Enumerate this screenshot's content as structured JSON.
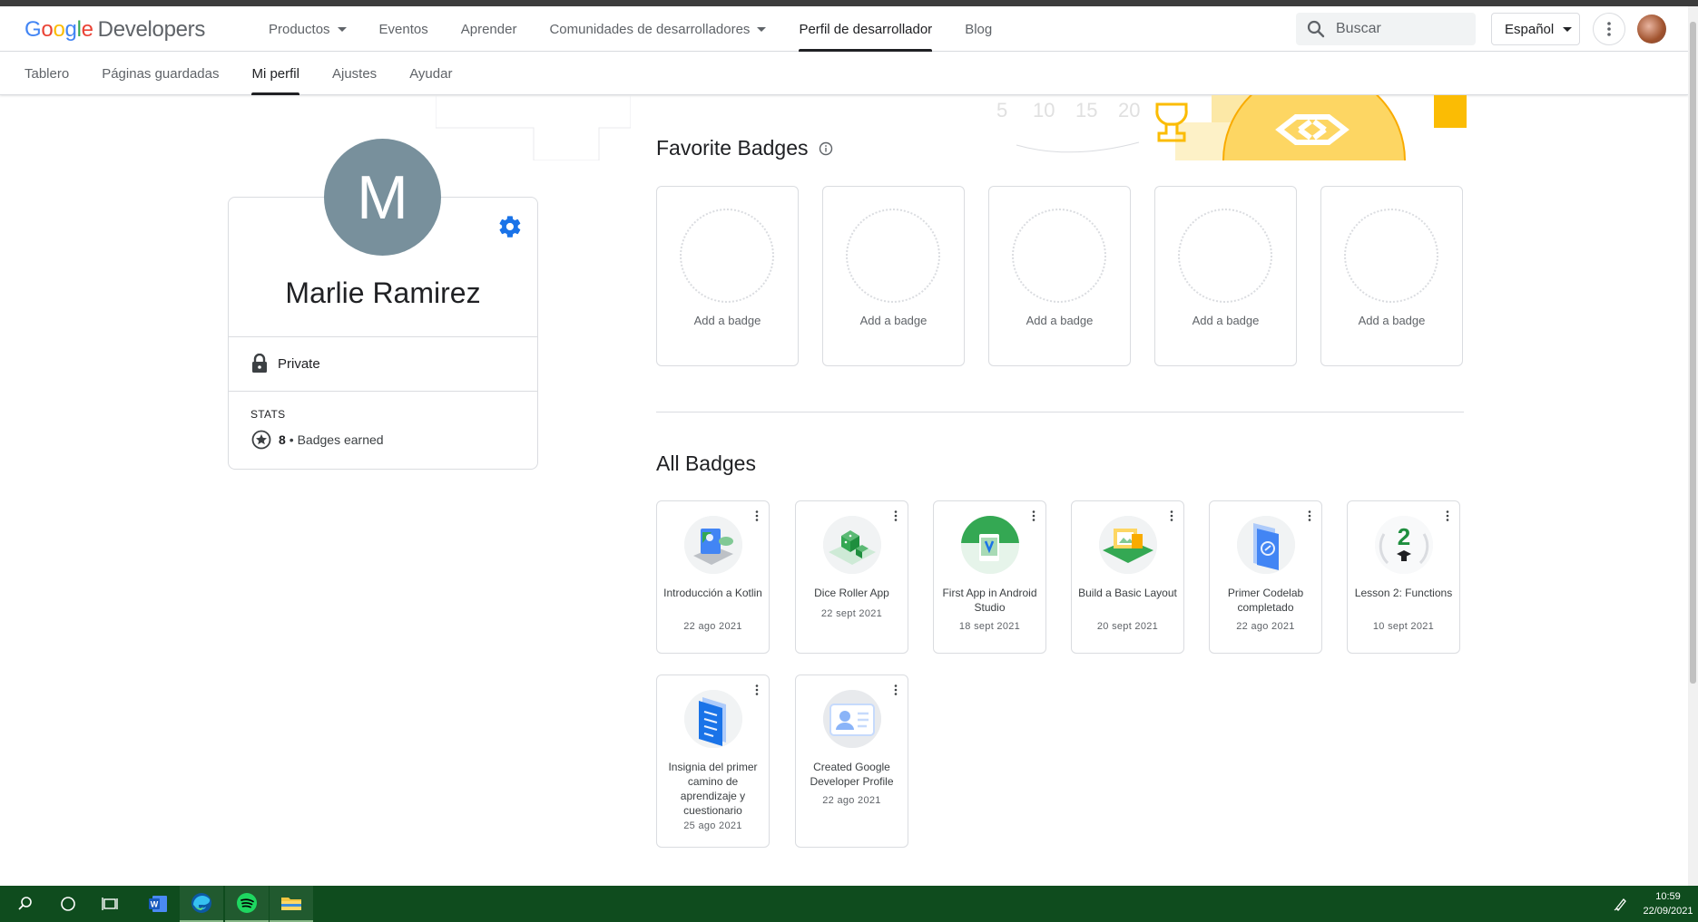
{
  "header": {
    "logo_google": "Google",
    "logo_dev": "Developers",
    "nav": [
      {
        "label": "Productos",
        "dropdown": true
      },
      {
        "label": "Eventos",
        "dropdown": false
      },
      {
        "label": "Aprender",
        "dropdown": false
      },
      {
        "label": "Comunidades de desarrolladores",
        "dropdown": true
      },
      {
        "label": "Perfil de desarrollador",
        "dropdown": false,
        "active": true
      },
      {
        "label": "Blog",
        "dropdown": false
      }
    ],
    "search_placeholder": "Buscar",
    "language": "Español"
  },
  "subnav": [
    {
      "label": "Tablero"
    },
    {
      "label": "Páginas guardadas"
    },
    {
      "label": "Mi perfil",
      "active": true
    },
    {
      "label": "Ajustes"
    },
    {
      "label": "Ayudar"
    }
  ],
  "banner": {
    "numbers": [
      "5",
      "10",
      "15",
      "20"
    ]
  },
  "profile": {
    "initial": "M",
    "name": "Marlie Ramirez",
    "privacy": "Private",
    "stats_label": "STATS",
    "badges_count": "8",
    "badges_label": "• Badges earned",
    "avatar_color": "#78909c",
    "accent": "#1a73e8"
  },
  "favorite_badges": {
    "title": "Favorite Badges",
    "slots": [
      "Add a badge",
      "Add a badge",
      "Add a badge",
      "Add a badge",
      "Add a badge"
    ]
  },
  "all_badges": {
    "title": "All Badges",
    "items": [
      {
        "name": "Introducción a Kotlin",
        "date": "22 ago 2021",
        "icon": "kotlin-laptop-icon"
      },
      {
        "name": "Dice Roller App",
        "date": "22 sept 2021",
        "icon": "dice-icon"
      },
      {
        "name": "First App in Android Studio",
        "date": "18 sept 2021",
        "icon": "android-studio-icon"
      },
      {
        "name": "Build a Basic Layout",
        "date": "20 sept 2021",
        "icon": "layout-icon"
      },
      {
        "name": "Primer Codelab completado",
        "date": "22 ago 2021",
        "icon": "codelab-icon"
      },
      {
        "name": "Lesson 2: Functions",
        "date": "10 sept 2021",
        "icon": "lesson-2-icon"
      },
      {
        "name": "Insignia del primer camino de aprendizaje y cuestionario",
        "date": "25 ago 2021",
        "icon": "quiz-document-icon"
      },
      {
        "name": "Created Google Developer Profile",
        "date": "22 ago 2021",
        "icon": "profile-card-icon"
      }
    ]
  },
  "taskbar": {
    "time": "10:59",
    "date": "22/09/2021"
  }
}
